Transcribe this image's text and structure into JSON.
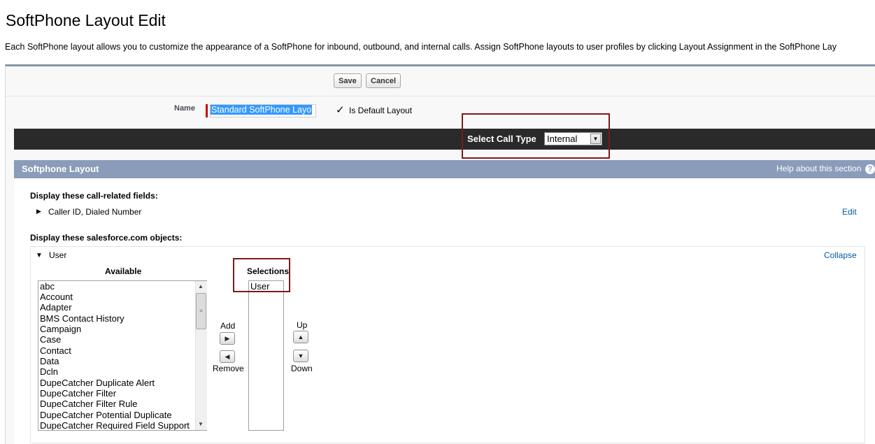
{
  "header": {
    "title": "SoftPhone Layout Edit",
    "description": "Each SoftPhone layout allows you to customize the appearance of a SoftPhone for inbound, outbound, and internal calls. Assign SoftPhone layouts to user profiles by clicking Layout Assignment in the SoftPhone Lay"
  },
  "toolbar": {
    "save_label": "Save",
    "cancel_label": "Cancel"
  },
  "form": {
    "name_label": "Name",
    "name_value": "Standard SoftPhone Layo",
    "default_checkmark": "✓",
    "default_label": "Is Default Layout"
  },
  "call_type": {
    "label": "Select Call Type",
    "selected": "Internal",
    "arrow_icon": "▼"
  },
  "section": {
    "title": "Softphone Layout",
    "help_link": "Help about this section",
    "help_icon": "?"
  },
  "fields": {
    "heading": "Display these call-related fields:",
    "expand_icon": "▶",
    "value": "Caller ID, Dialed Number",
    "edit_link": "Edit"
  },
  "objects": {
    "heading": "Display these salesforce.com objects:",
    "collapse_icon": "▼",
    "user_label": "User",
    "collapse_link": "Collapse",
    "available_label": "Available",
    "selections_label": "Selections",
    "available_items": [
      "abc",
      "Account",
      "Adapter",
      "BMS Contact History",
      "Campaign",
      "Case",
      "Contact",
      "Data",
      "Dcln",
      "DupeCatcher Duplicate Alert",
      "DupeCatcher Filter",
      "DupeCatcher Filter Rule",
      "DupeCatcher Potential Duplicate",
      "DupeCatcher Required Field Support"
    ],
    "selected_items": [
      "User"
    ],
    "scroll_up_icon": "▲",
    "scroll_down_icon": "▼",
    "scroll_grip_icon": "≡",
    "add_label": "Add",
    "add_icon": "▶",
    "remove_icon": "◀",
    "remove_label": "Remove",
    "up_label": "Up",
    "up_icon": "▲",
    "down_icon": "▼",
    "down_label": "Down"
  }
}
